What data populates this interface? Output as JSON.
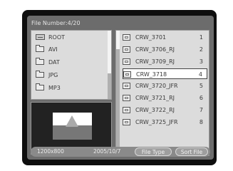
{
  "header": {
    "file_number": "File Number:4/20"
  },
  "folders": [
    {
      "label": "ROOT",
      "icon": "drive-icon"
    },
    {
      "label": "AVI",
      "icon": "folder-icon"
    },
    {
      "label": "DAT",
      "icon": "folder-icon"
    },
    {
      "label": "JPG",
      "icon": "folder-icon"
    },
    {
      "label": "MP3",
      "icon": "folder-icon"
    }
  ],
  "files": [
    {
      "name": "CRW_3701",
      "num": "1"
    },
    {
      "name": "CRW_3706_RJ",
      "num": "2"
    },
    {
      "name": "CRW_3709_RJ",
      "num": "3"
    },
    {
      "name": "CRW_3718",
      "num": "4"
    },
    {
      "name": "CRW_3720_JFR",
      "num": "5"
    },
    {
      "name": "CRW_3721_RJ",
      "num": "6"
    },
    {
      "name": "CRW_3722_RJ",
      "num": "7"
    },
    {
      "name": "CRW_3725_JFR",
      "num": "8"
    }
  ],
  "status": {
    "resolution": "1200x800",
    "date": "2005/10/7"
  },
  "buttons": {
    "file_type": "File Type",
    "sort_file": "Sort File"
  },
  "colors": {
    "screen_bg": "#6c6c6c",
    "pane_bg": "#dcdcdc",
    "bezel": "#0e0e0e"
  }
}
